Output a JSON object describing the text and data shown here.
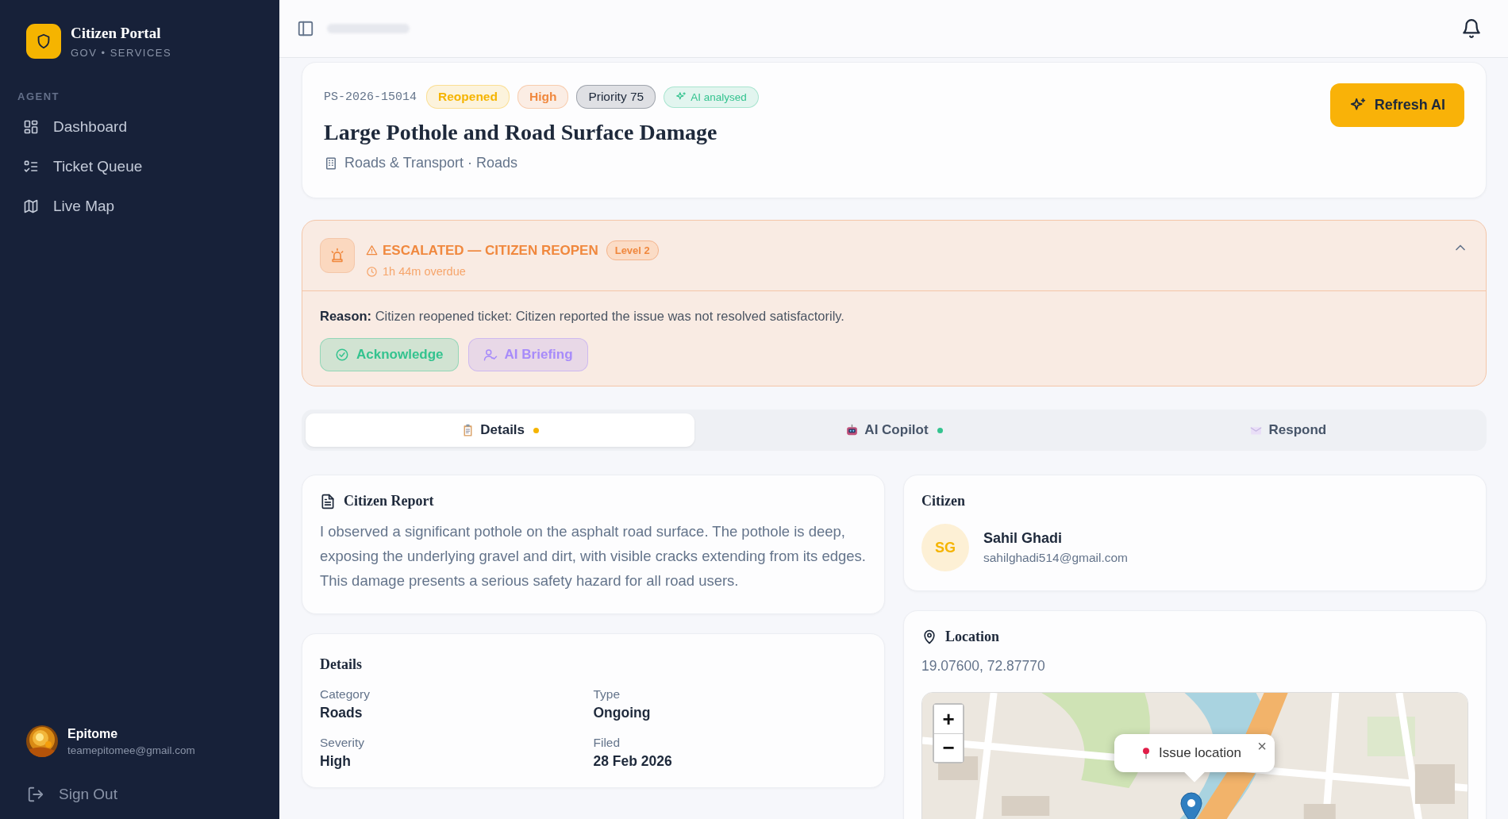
{
  "sidebar": {
    "brand": {
      "title": "Citizen Portal",
      "subtitle": "GOV • SERVICES"
    },
    "section": "AGENT",
    "items": [
      {
        "label": "Dashboard"
      },
      {
        "label": "Ticket Queue"
      },
      {
        "label": "Live Map"
      }
    ],
    "user": {
      "name": "Epitome",
      "email": "teamepitomee@gmail.com"
    },
    "sign_out": "Sign Out"
  },
  "ticket": {
    "id": "PS-2026-15014",
    "badges": [
      {
        "label": "Reopened",
        "color": "#f5b400"
      },
      {
        "label": "High",
        "color": "#f0883e"
      },
      {
        "label": "Priority 75",
        "color": "#1e293b"
      },
      {
        "label": "AI analysed",
        "color": "#34c38f"
      }
    ],
    "title": "Large Pothole and Road Surface Damage",
    "category": "Roads & Transport · Roads",
    "action": "Refresh AI"
  },
  "escalation": {
    "title": "ESCALATED — CITIZEN REOPEN",
    "level": "Level 2",
    "overdue": "1h 44m overdue",
    "expanded": true,
    "reason": "**Reason:** Citizen reopened ticket: Citizen reported the issue was not resolved satisfactorily.",
    "actions": [
      {
        "label": "Acknowledge",
        "color": "#34c38f"
      },
      {
        "label": "AI Briefing",
        "color": "#a78bfa"
      }
    ]
  },
  "tabs": [
    {
      "label": "Details",
      "selected": true,
      "color": "#f5b400"
    },
    {
      "label": "AI Copilot",
      "selected": false,
      "color": "#34c38f"
    },
    {
      "label": "Respond",
      "selected": false
    }
  ],
  "citizen_report": {
    "title": "Citizen Report",
    "text": "I observed a significant pothole on the asphalt road surface. The pothole is deep, exposing the underlying gravel and dirt, with visible cracks extending from its edges. This damage presents a serious safety hazard for all road users."
  },
  "citizen": {
    "title": "Citizen",
    "initials": "SG",
    "name": "Sahil Ghadi",
    "email": "sahilghadi514@gmail.com"
  },
  "details": {
    "title": "Details",
    "fields": [
      {
        "label": "Category",
        "value": "Roads"
      },
      {
        "label": "Type",
        "value": "Ongoing"
      },
      {
        "label": "Severity",
        "value": "High"
      },
      {
        "label": "Filed",
        "value": "28 Feb 2026"
      }
    ]
  },
  "location": {
    "title": "Location",
    "coordinates": "19.07600, 72.87770",
    "map": {
      "kind": "picture",
      "zoom_in": "+",
      "zoom_out": "−",
      "popup": "Issue location",
      "close": "×"
    }
  }
}
